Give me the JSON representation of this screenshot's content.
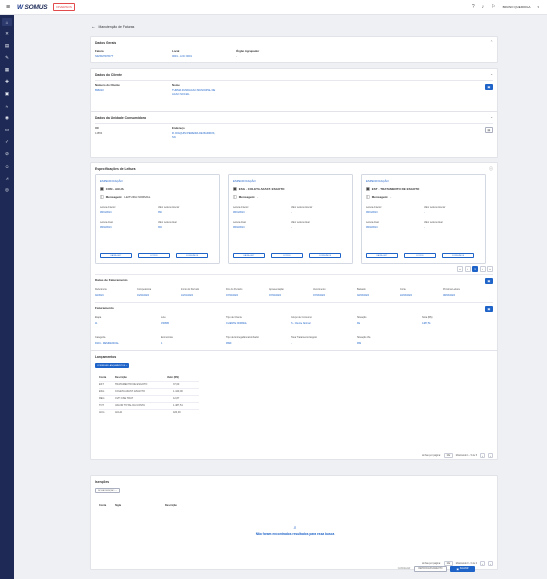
{
  "topbar": {
    "logo_prefix": "W",
    "logo_text": "SOMUS",
    "env_badge": "DIVERSOS",
    "user_name": "BRUNO QUEIROGA"
  },
  "sidebar": {
    "icons": [
      "home-icon",
      "tools-icon",
      "list-icon",
      "calendar-icon",
      "grid-icon",
      "tag-icon",
      "document-icon",
      "chart-icon",
      "alert-icon",
      "box-icon",
      "settings-icon",
      "edit-icon",
      "person-icon",
      "graph-icon",
      "circle-icon"
    ]
  },
  "page": {
    "title": "Manutenção de Faturas"
  },
  "dados_gerais": {
    "title": "Dados Gerais",
    "fields": [
      {
        "label": "Fatura",
        "value": "S02SM7D7D7T"
      },
      {
        "label": "Local",
        "value": "0001 - LOC 0001"
      },
      {
        "label": "Órgão Agrupador",
        "value": "-"
      }
    ]
  },
  "dados_cliente": {
    "title": "Dados do Cliente",
    "numero_label": "Número do Cliente",
    "numero_value": "896010",
    "nome_label": "Nome",
    "nome_value_1": "TURMA FUNDACAO MUNICIPAL DE",
    "nome_value_2": "ACAO SOCIAL"
  },
  "dados_uc": {
    "title": "Dados da Unidade Consumidora",
    "uc_label": "UC",
    "uc_value": "14853",
    "endereco_label": "Endereço",
    "endereco_value_1": "R JOAQUIM PEREIRA DE BARROS,",
    "endereco_value_2": "SN"
  },
  "spec_leitura": {
    "title": "Especificações de Leitura",
    "cards": [
      {
        "header": "ESPECIFICAÇÃO",
        "title": "CON - AGUA",
        "msg_label": "Mensagem:",
        "msg_value": "LEITURA NORMAL",
        "labels": [
          "Leitura Anterior",
          "Valor Leitura Anterior",
          "Leitura Atual",
          "Valor Leitura Atual"
        ],
        "values": [
          "08/01/2024",
          "350",
          "08/02/2024",
          "384"
        ],
        "buttons": [
          "FAIXA LEIT",
          "FOTOS",
          "CONSUMOS"
        ]
      },
      {
        "header": "ESPECIFICAÇÃO",
        "title": "ESG - COLETA AFAST. ESGOTO",
        "msg_label": "Mensagem:",
        "msg_value": "-",
        "labels": [
          "Leitura Anterior",
          "Valor Leitura Anterior",
          "Leitura Atual",
          "Valor Leitura Atual"
        ],
        "values": [
          "08/01/2024",
          "-",
          "08/02/2024",
          "-"
        ],
        "buttons": [
          "FAIXA LEIT",
          "FOTOS",
          "CONSUMOS"
        ]
      },
      {
        "header": "ESPECIFICAÇÃO",
        "title": "EST - TRATAMENTO DE ESGOTO",
        "msg_label": "Mensagem:",
        "msg_value": "-",
        "labels": [
          "Leitura Anterior",
          "Valor Leitura Anterior",
          "Leitura Atual",
          "Valor Leitura Atual"
        ],
        "values": [
          "08/01/2024",
          "-",
          "08/02/2024",
          "-"
        ],
        "buttons": [
          "FAIXA LEIT",
          "FOTOS",
          "CONSUMOS"
        ]
      }
    ],
    "pager": [
      "«",
      "‹",
      "1",
      "›",
      "»"
    ]
  },
  "datas_faturamento": {
    "title": "Datas de Faturamento",
    "cols": [
      {
        "h": "Referência",
        "v": "02/2024"
      },
      {
        "h": "Competência",
        "v": "01/02/2024"
      },
      {
        "h": "Início do Período",
        "v": "10/01/2024"
      },
      {
        "h": "Fim do Período",
        "v": "07/02/2024"
      },
      {
        "h": "Apresentação",
        "v": "07/02/2024"
      },
      {
        "h": "Vencimento",
        "v": "07/03/2024"
      },
      {
        "h": "Baixado",
        "v": "02/03/2024"
      },
      {
        "h": "Corte",
        "v": "22/03/2024"
      },
      {
        "h": "Próxima Leitura",
        "v": "08/03/2024"
      }
    ]
  },
  "faturamento": {
    "title": "Faturamento",
    "row1": [
      {
        "h": "Etapa",
        "v": "11"
      },
      {
        "h": "Lote",
        "v": "150865"
      },
      {
        "h": "Tipo de Cliente",
        "v": "CLIENTE NORMAL"
      },
      {
        "h": "Grupo de Consumo",
        "v": "S - Cliente Normal"
      },
      {
        "h": "Situação",
        "v": "FE"
      },
      {
        "h": "Nota (R$)",
        "v": "1487,51"
      }
    ],
    "row2": [
      {
        "h": "Categoria",
        "v": "R101 - RESIDENCIAL"
      },
      {
        "h": "Economias",
        "v": "1"
      },
      {
        "h": "Tipo de Entrega/Encaminhador",
        "v": "9999"
      },
      {
        "h": "Taxa Tratamento Esgoto",
        "v": "-"
      },
      {
        "h": "Situação Via",
        "v": "999"
      }
    ]
  },
  "lancamentos": {
    "title": "Lançamentos",
    "add_button": "CORRIGIR LANÇAMENTOS",
    "headers": [
      "Conta",
      "Descrição",
      "Valor (R$)"
    ],
    "rows": [
      [
        "EST",
        "TRATAMENTO DE ESGOTO",
        "37,60"
      ],
      [
        "ESG",
        "COLETA AFAST. ESGOTO",
        "1.440,00"
      ],
      [
        "REG",
        "CVH CSE TRAT",
        "12,87"
      ],
      [
        "TOT",
        "VALOR TOTAL DA CONTA",
        "1.487,51"
      ],
      [
        "ACG",
        "AGUA",
        "420,00"
      ]
    ],
    "per_page_label": "Linhas por página:",
    "per_page": "10",
    "range": "Mostrando 1 - 5 de 5"
  },
  "isencoes": {
    "title": "Isenções",
    "add_button": "NOVA ISENÇÃO",
    "headers": [
      "Conta",
      "Sigla",
      "Descrição"
    ],
    "empty_text": "Não foram encontrados resultados para essa busca",
    "per_page_label": "Linhas por página:",
    "per_page": "10",
    "range": "Mostrando 0 - 0 de 0"
  },
  "footer": {
    "cancel": "CANCELAR",
    "reprocess": "REPROCESSAMENTO",
    "save": "SALVAR"
  }
}
